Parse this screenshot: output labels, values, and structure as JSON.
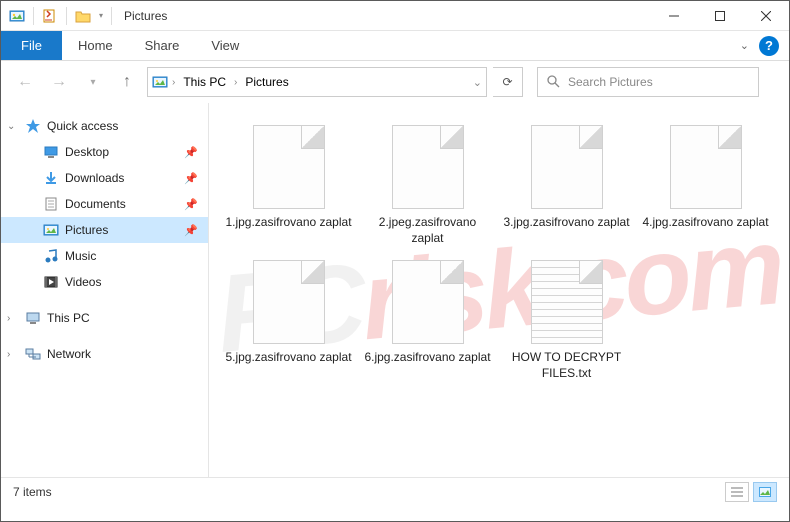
{
  "title": "Pictures",
  "ribbon": {
    "file": "File",
    "home": "Home",
    "share": "Share",
    "view": "View"
  },
  "breadcrumb": {
    "root": "This PC",
    "current": "Pictures"
  },
  "search": {
    "placeholder": "Search Pictures"
  },
  "sidebar": {
    "quickaccess": "Quick access",
    "items": [
      {
        "label": "Desktop",
        "pinned": true
      },
      {
        "label": "Downloads",
        "pinned": true
      },
      {
        "label": "Documents",
        "pinned": true
      },
      {
        "label": "Pictures",
        "pinned": true,
        "selected": true
      },
      {
        "label": "Music",
        "pinned": false
      },
      {
        "label": "Videos",
        "pinned": false
      }
    ],
    "thispc": "This PC",
    "network": "Network"
  },
  "files": [
    {
      "name": "1.jpg.zasifrovano zaplat",
      "type": "file"
    },
    {
      "name": "2.jpeg.zasifrovano zaplat",
      "type": "file"
    },
    {
      "name": "3.jpg.zasifrovano zaplat",
      "type": "file"
    },
    {
      "name": "4.jpg.zasifrovano zaplat",
      "type": "file"
    },
    {
      "name": "5.jpg.zasifrovano zaplat",
      "type": "file"
    },
    {
      "name": "6.jpg.zasifrovano zaplat",
      "type": "file"
    },
    {
      "name": "HOW TO DECRYPT FILES.txt",
      "type": "txt"
    }
  ],
  "status": {
    "count": "7 items"
  },
  "watermark": {
    "pc": "PC",
    "rest": "risk.com"
  }
}
